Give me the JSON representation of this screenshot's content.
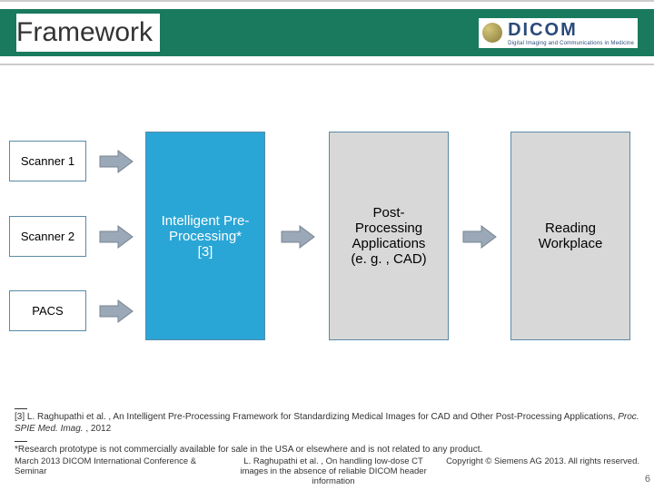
{
  "header": {
    "title": "Framework",
    "logo_main": "DICOM",
    "logo_sub": "Digital Imaging and Communications in Medicine"
  },
  "diagram": {
    "scanner1": "Scanner 1",
    "scanner2": "Scanner 2",
    "pacs": "PACS",
    "preproc_line1": "Intelligent Pre-",
    "preproc_line2": "Processing*",
    "preproc_line3": "[3]",
    "postproc_line1": "Post-",
    "postproc_line2": "Processing",
    "postproc_line3": "Applications",
    "postproc_line4": "(e. g. , CAD)",
    "reading_line1": "Reading",
    "reading_line2": "Workplace"
  },
  "footnotes": {
    "ref3_a": "[3] L. Raghupathi et al. , An Intelligent Pre-Processing Framework for Standardizing Medical Images for CAD and Other Post-Processing Applications, ",
    "ref3_b": "Proc. SPIE Med. Imag.",
    "ref3_c": " , 2012",
    "asterisk": "*Research prototype is not commercially available for sale in the USA or elsewhere and is not related to any product."
  },
  "footer": {
    "left": "March 2013 DICOM International Conference & Seminar",
    "mid": "L. Raghupathi et al. , On handling low-dose CT images in the absence of reliable DICOM header information",
    "right": "Copyright © Siemens AG 2013. All rights reserved.",
    "page": "6"
  },
  "colors": {
    "highlight": "#2aa6d6",
    "box_border": "#5a8aa8",
    "grey_box": "#d8d8d8",
    "arrow": "#9aa8b8"
  }
}
